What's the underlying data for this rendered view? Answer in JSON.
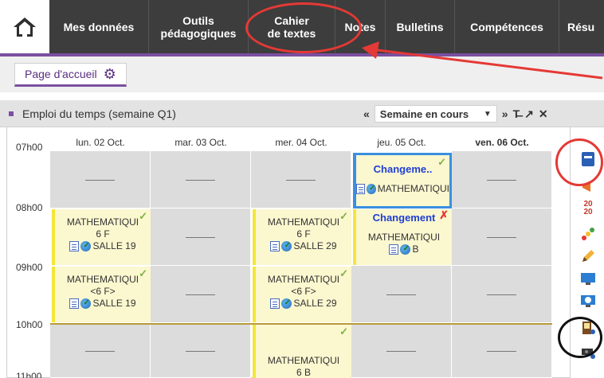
{
  "nav": {
    "items": [
      {
        "label": "Mes données"
      },
      {
        "label": "Outils\npédagogiques"
      },
      {
        "label": "Cahier\nde textes"
      },
      {
        "label": "Notes"
      },
      {
        "label": "Bulletins"
      },
      {
        "label": "Compétences"
      },
      {
        "label": "Résu"
      }
    ]
  },
  "tab": {
    "label": "Page d'accueil"
  },
  "widget": {
    "title": "Emploi du temps (semaine Q1)",
    "week_select": "Semaine en cours"
  },
  "days": [
    "lun. 02 Oct.",
    "mar. 03 Oct.",
    "mer. 04 Oct.",
    "jeu. 05 Oct.",
    "ven. 06 Oct."
  ],
  "times": [
    "07h00",
    "08h00",
    "09h00",
    "10h00",
    "11h00"
  ],
  "courses": [
    {
      "title": "MATHEMATIQUI",
      "group": "6 F",
      "room": "SALLE 19"
    },
    {
      "title": "MATHEMATIQUI",
      "group": "<6 F>",
      "room": "SALLE 19"
    },
    {
      "title": "MATHEMATIQUI",
      "group": "6 F",
      "room": "SALLE 29"
    },
    {
      "title": "MATHEMATIQUI",
      "group": "<6 F>",
      "room": "SALLE 29"
    },
    {
      "title": "MATHEMATIQUI",
      "group": "6 B",
      "room": ""
    },
    {
      "status": "Changeme..",
      "title": "MATHEMATIQUI"
    },
    {
      "status": "Changement",
      "title": "MATHEMATIQUI",
      "room": "B"
    }
  ],
  "colors": {
    "nav_bg": "#3d3d3d",
    "accent_purple": "#7b4fa0",
    "course_bg": "#fbf7cf",
    "course_border": "#f4e63a",
    "changed_text": "#1f3fd4",
    "annotation_red": "#e53935"
  }
}
